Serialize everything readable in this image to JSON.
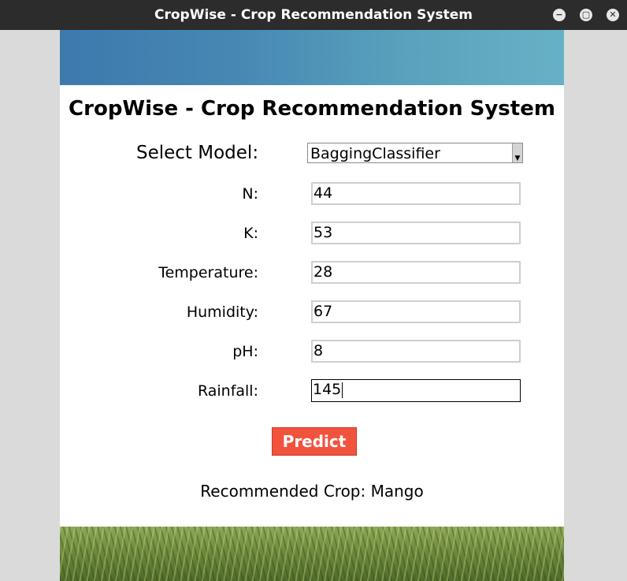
{
  "window": {
    "title": "CropWise - Crop Recommendation System",
    "controls": {
      "minimize": "−",
      "maximize": "▢",
      "close": "✕"
    }
  },
  "app": {
    "heading": "CropWise - Crop Recommendation System",
    "model": {
      "label": "Select Model:",
      "value": "BaggingClassifier"
    },
    "fields": [
      {
        "label": "N:",
        "value": "44"
      },
      {
        "label": "K:",
        "value": "53"
      },
      {
        "label": "Temperature:",
        "value": "28"
      },
      {
        "label": "Humidity:",
        "value": "67"
      },
      {
        "label": "pH:",
        "value": "8"
      },
      {
        "label": "Rainfall:",
        "value": "145"
      }
    ],
    "predict_label": "Predict",
    "result_text": "Recommended Crop: Mango"
  },
  "colors": {
    "titlebar": "#2c2c2c",
    "predict": "#f1533d",
    "background": "#dadada"
  }
}
